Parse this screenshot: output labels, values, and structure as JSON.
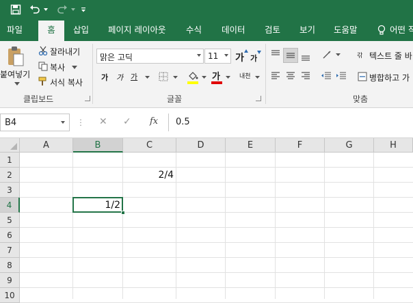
{
  "quick_access": {
    "save_icon": "save-icon",
    "undo_icon": "undo-icon",
    "redo_icon": "redo-icon",
    "customize_icon": "customize-qat-icon"
  },
  "tabs": [
    {
      "label": "파일",
      "active": false
    },
    {
      "label": "홈",
      "active": true
    },
    {
      "label": "삽입",
      "active": false
    },
    {
      "label": "페이지 레이아웃",
      "active": false
    },
    {
      "label": "수식",
      "active": false
    },
    {
      "label": "데이터",
      "active": false
    },
    {
      "label": "검토",
      "active": false
    },
    {
      "label": "보기",
      "active": false
    },
    {
      "label": "도움말",
      "active": false
    },
    {
      "label": "어떤 작",
      "active": false
    }
  ],
  "ribbon": {
    "clipboard": {
      "paste_label": "붙여넣기",
      "cut_label": "잘라내기",
      "copy_label": "복사",
      "format_painter_label": "서식 복사",
      "group_label": "클립보드"
    },
    "font": {
      "font_name": "맑은 고딕",
      "font_size": "11",
      "grow_glyph": "가",
      "shrink_glyph": "가",
      "bold_glyph": "가",
      "italic_glyph": "가",
      "underline_glyph": "가",
      "font_color_glyph": "가",
      "phonetic_glyph": "내천",
      "group_label": "글꼴",
      "highlight_color": "#ffff00",
      "font_color": "#e00000"
    },
    "alignment": {
      "wrap_text_label": "텍스트 줄 바",
      "merge_label": "병합하고 가",
      "wrap_glyph": "갂",
      "group_label": "맞춤"
    }
  },
  "formula_bar": {
    "name_box": "B4",
    "cancel_glyph": "✕",
    "enter_glyph": "✓",
    "fx_label": "fx",
    "formula_value": "0.5"
  },
  "grid": {
    "columns": [
      "A",
      "B",
      "C",
      "D",
      "E",
      "F",
      "G",
      "H"
    ],
    "rows": [
      "1",
      "2",
      "3",
      "4",
      "5",
      "6",
      "7",
      "8",
      "9",
      "10"
    ],
    "selected_cell": "B4",
    "cells": {
      "C2": "2/4",
      "B4": "1/2"
    }
  },
  "colors": {
    "accent": "#217346",
    "ribbon_bg": "#f3f3f3",
    "header_bg": "#e6e6e6"
  }
}
